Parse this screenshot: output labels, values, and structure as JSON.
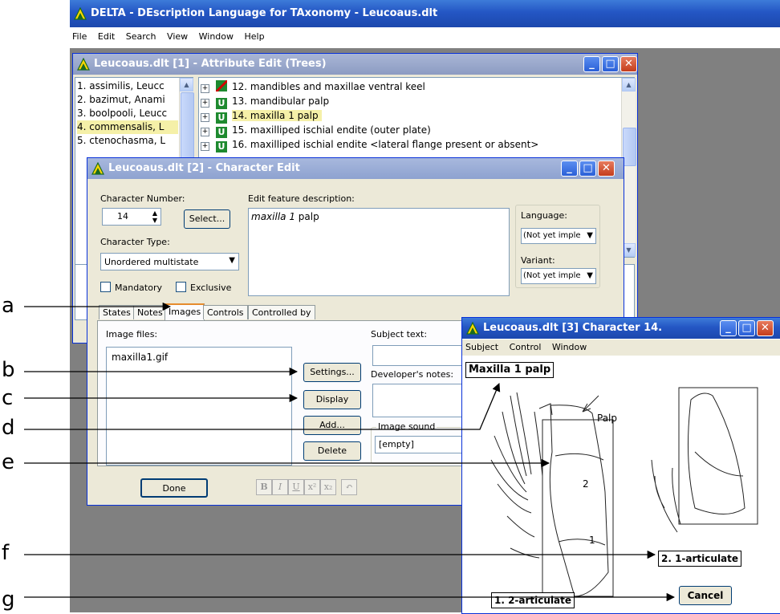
{
  "app": {
    "title": "DELTA - DEscription Language for TAxonomy - Leucoaus.dlt",
    "menu": [
      "File",
      "Edit",
      "Search",
      "View",
      "Window",
      "Help"
    ]
  },
  "attribute_window": {
    "title": "Leucoaus.dlt [1] - Attribute Edit (Trees)",
    "taxa": [
      "1. assimilis, Leucc",
      "2. bazimut, Anami",
      "3. boolpooli, Leucc",
      "4. commensalis, L",
      "5. ctenochasma, L"
    ],
    "characters": [
      {
        "text": "12. mandibles and maxillae ventral keel",
        "badge": "slash"
      },
      {
        "text": "13. mandibular palp",
        "badge": "U"
      },
      {
        "text": "14. maxilla 1 palp",
        "badge": "U"
      },
      {
        "text": "15. maxilliped ischial endite (outer plate)",
        "badge": "U"
      },
      {
        "text": "16. maxilliped ischial endite <lateral flange present or absent>",
        "badge": "U"
      }
    ]
  },
  "character_edit": {
    "title": "Leucoaus.dlt [2] - Character Edit",
    "char_number_label": "Character Number:",
    "char_number": "14",
    "select_button": "Select...",
    "char_type_label": "Character Type:",
    "char_type": "Unordered multistate",
    "mandatory_label": "Mandatory",
    "exclusive_label": "Exclusive",
    "feature_label": "Edit feature description:",
    "feature_italic": "maxilla 1",
    "feature_rest": " palp",
    "language_label": "Language:",
    "language_value": "(Not yet imple",
    "variant_label": "Variant:",
    "variant_value": "(Not yet imple",
    "tabs": [
      "States",
      "Notes",
      "Images",
      "Controls",
      "Controlled by"
    ],
    "image_files_label": "Image files:",
    "image_file": "maxilla1.gif",
    "settings_button": "Settings...",
    "display_button": "Display",
    "add_button": "Add...",
    "delete_button": "Delete",
    "subject_text_label": "Subject text:",
    "developer_notes_label": "Developer's notes:",
    "image_sound_label": "Image sound",
    "image_sound_value": "[empty]",
    "done_button": "Done",
    "format_buttons": [
      "B",
      "I",
      "U",
      "x²",
      "x₂",
      "↶"
    ]
  },
  "image_window": {
    "title": "Leucoaus.dlt [3] Character 14.",
    "menu": [
      "Subject",
      "Control",
      "Window"
    ],
    "subject_overlay": "Maxilla 1 palp",
    "palp_label": "Palp",
    "seg_2": "2",
    "seg_1": "1",
    "state_2": "2. 1-articulate",
    "state_1": "1. 2-articulate",
    "cancel_button": "Cancel"
  },
  "callouts": [
    "a",
    "b",
    "c",
    "d",
    "e",
    "f",
    "g"
  ]
}
